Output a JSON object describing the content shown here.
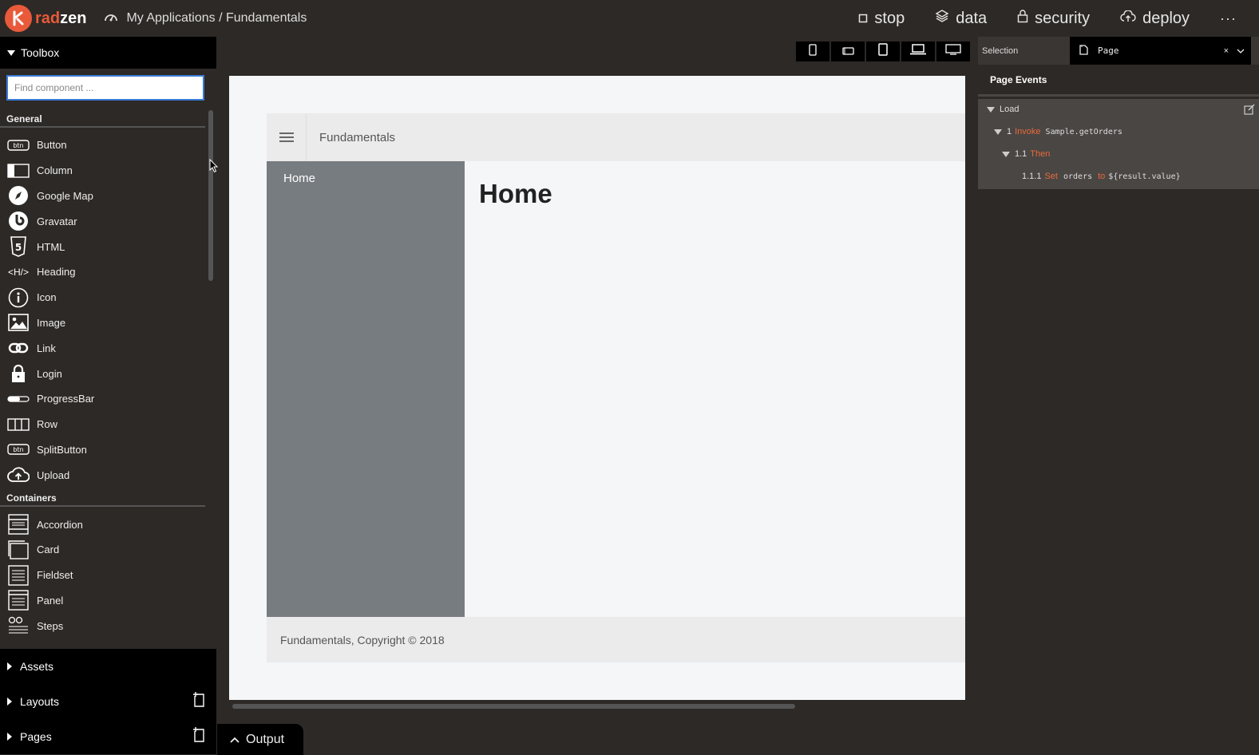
{
  "app": {
    "logo_text_rad": "rad",
    "logo_text_zen": "zen",
    "breadcrumb": "My Applications / Fundamentals"
  },
  "topnav": {
    "stop": "stop",
    "data": "data",
    "security": "security",
    "deploy": "deploy",
    "more": "···"
  },
  "toolbox": {
    "title": "Toolbox",
    "search_placeholder": "Find component ...",
    "groups": [
      {
        "name": "General",
        "items": [
          {
            "label": "Button",
            "icon": "btn"
          },
          {
            "label": "Column",
            "icon": "column"
          },
          {
            "label": "Google Map",
            "icon": "compass"
          },
          {
            "label": "Gravatar",
            "icon": "gravatar"
          },
          {
            "label": "HTML",
            "icon": "html5"
          },
          {
            "label": "Heading",
            "icon": "<H/>"
          },
          {
            "label": "Icon",
            "icon": "info"
          },
          {
            "label": "Image",
            "icon": "image"
          },
          {
            "label": "Link",
            "icon": "link"
          },
          {
            "label": "Login",
            "icon": "lock"
          },
          {
            "label": "ProgressBar",
            "icon": "progress"
          },
          {
            "label": "Row",
            "icon": "row"
          },
          {
            "label": "SplitButton",
            "icon": "btn"
          },
          {
            "label": "Upload",
            "icon": "upload"
          }
        ]
      },
      {
        "name": "Containers",
        "items": [
          {
            "label": "Accordion",
            "icon": "accordion"
          },
          {
            "label": "Card",
            "icon": "card"
          },
          {
            "label": "Fieldset",
            "icon": "fieldset"
          },
          {
            "label": "Panel",
            "icon": "panel"
          },
          {
            "label": "Steps",
            "icon": "steps"
          }
        ]
      }
    ]
  },
  "sections": {
    "assets": "Assets",
    "layouts": "Layouts",
    "pages": "Pages"
  },
  "output": {
    "label": "Output"
  },
  "canvas": {
    "header_title": "Fundamentals",
    "sidebar_home": "Home",
    "heading": "Home",
    "footer": "Fundamentals, Copyright © 2018"
  },
  "right_panel": {
    "selection_label": "Selection",
    "selection_value": "Page",
    "close": "×",
    "page_events_title": "Page Events",
    "tree": {
      "load": "Load",
      "step1_num": "1",
      "step1_kw": "Invoke",
      "step1_val": "Sample.getOrders",
      "step11_num": "1.1",
      "step11_kw": "Then",
      "step111_num": "1.1.1",
      "step111_kw": "Set",
      "step111_var": "orders",
      "step111_kw2": "to",
      "step111_val": "${result.value}"
    }
  },
  "colors": {
    "accent": "#e85a3a",
    "background": "#2d2926",
    "focus": "#3a7bd5"
  }
}
